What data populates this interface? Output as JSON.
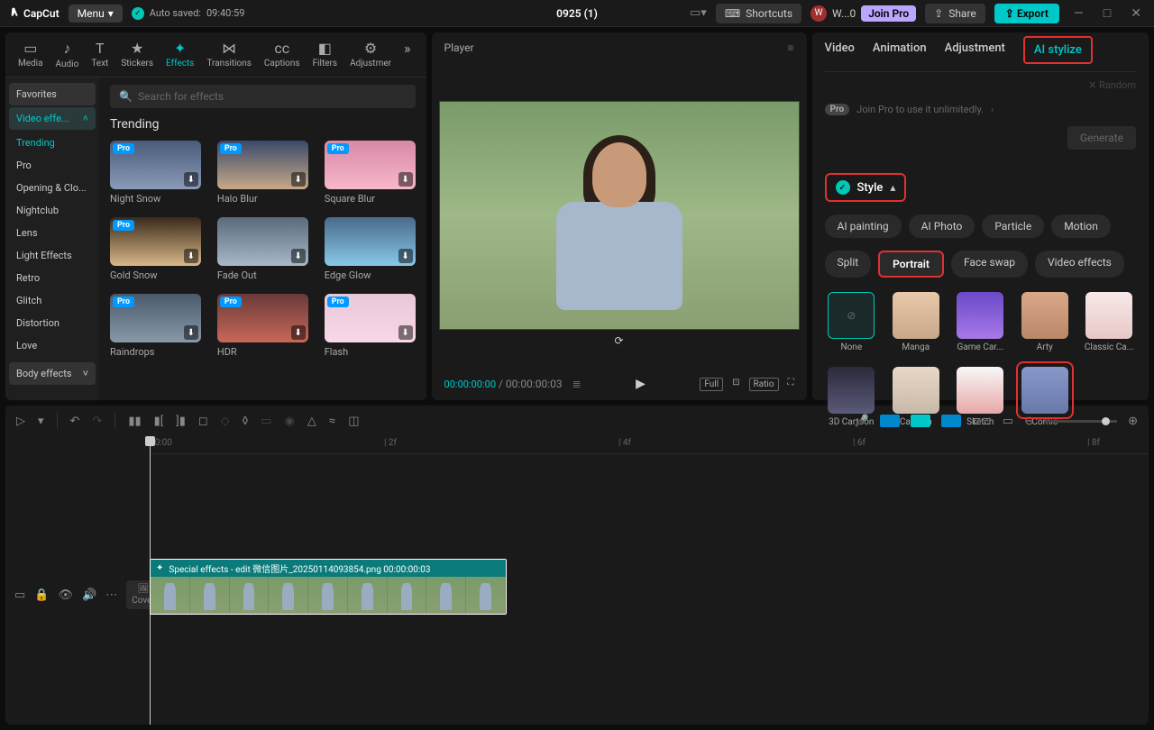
{
  "topbar": {
    "logo": "CapCut",
    "menu": "Menu",
    "autosave_label": "Auto saved:",
    "autosave_time": "09:40:59",
    "project_title": "0925 (1)",
    "shortcuts": "Shortcuts",
    "user_short": "W...0",
    "join_pro": "Join Pro",
    "share": "Share",
    "export": "Export"
  },
  "tool_tabs": [
    "Media",
    "Audio",
    "Text",
    "Stickers",
    "Effects",
    "Transitions",
    "Captions",
    "Filters",
    "Adjustmer"
  ],
  "side": {
    "favorites": "Favorites",
    "video_effects": "Video effe...",
    "items": [
      "Trending",
      "Pro",
      "Opening & Clo...",
      "Nightclub",
      "Lens",
      "Light Effects",
      "Retro",
      "Glitch",
      "Distortion",
      "Love"
    ],
    "body_effects": "Body effects"
  },
  "effects": {
    "search_placeholder": "Search for effects",
    "section": "Trending",
    "items": [
      {
        "name": "Night Snow",
        "pro": true
      },
      {
        "name": "Halo Blur",
        "pro": true
      },
      {
        "name": "Square Blur",
        "pro": true
      },
      {
        "name": "Gold Snow",
        "pro": true
      },
      {
        "name": "Fade Out",
        "pro": false
      },
      {
        "name": "Edge Glow",
        "pro": false
      },
      {
        "name": "Raindrops",
        "pro": true
      },
      {
        "name": "HDR",
        "pro": true
      },
      {
        "name": "Flash",
        "pro": true
      }
    ]
  },
  "player": {
    "title": "Player",
    "time_current": "00:00:00:00",
    "time_total": "00:00:00:03",
    "full": "Full",
    "ratio": "Ratio"
  },
  "right": {
    "tabs": [
      "Video",
      "Animation",
      "Adjustment",
      "AI stylize"
    ],
    "random": "Random",
    "pro": "Pro",
    "join_msg": "Join Pro to use it unlimitedly.",
    "generate": "Generate",
    "style_label": "Style",
    "chips_row1": [
      "AI painting",
      "AI Photo",
      "Particle",
      "Motion"
    ],
    "chips_row2": [
      "Split",
      "Portrait",
      "Face swap",
      "Video effects"
    ],
    "styles_row1": [
      "None",
      "Manga",
      "Game Car...",
      "Arty",
      "Classic Ca..."
    ],
    "styles_row2": [
      "3D Cartoon",
      "Cartoon",
      "Sketch",
      "Comic"
    ]
  },
  "timeline": {
    "marks": [
      "00:00",
      "2f",
      "4f",
      "6f",
      "8f"
    ],
    "cover": "Cover",
    "clip_label": "Special effects - edit   微信图片_20250114093854.png   00:00:00:03"
  }
}
